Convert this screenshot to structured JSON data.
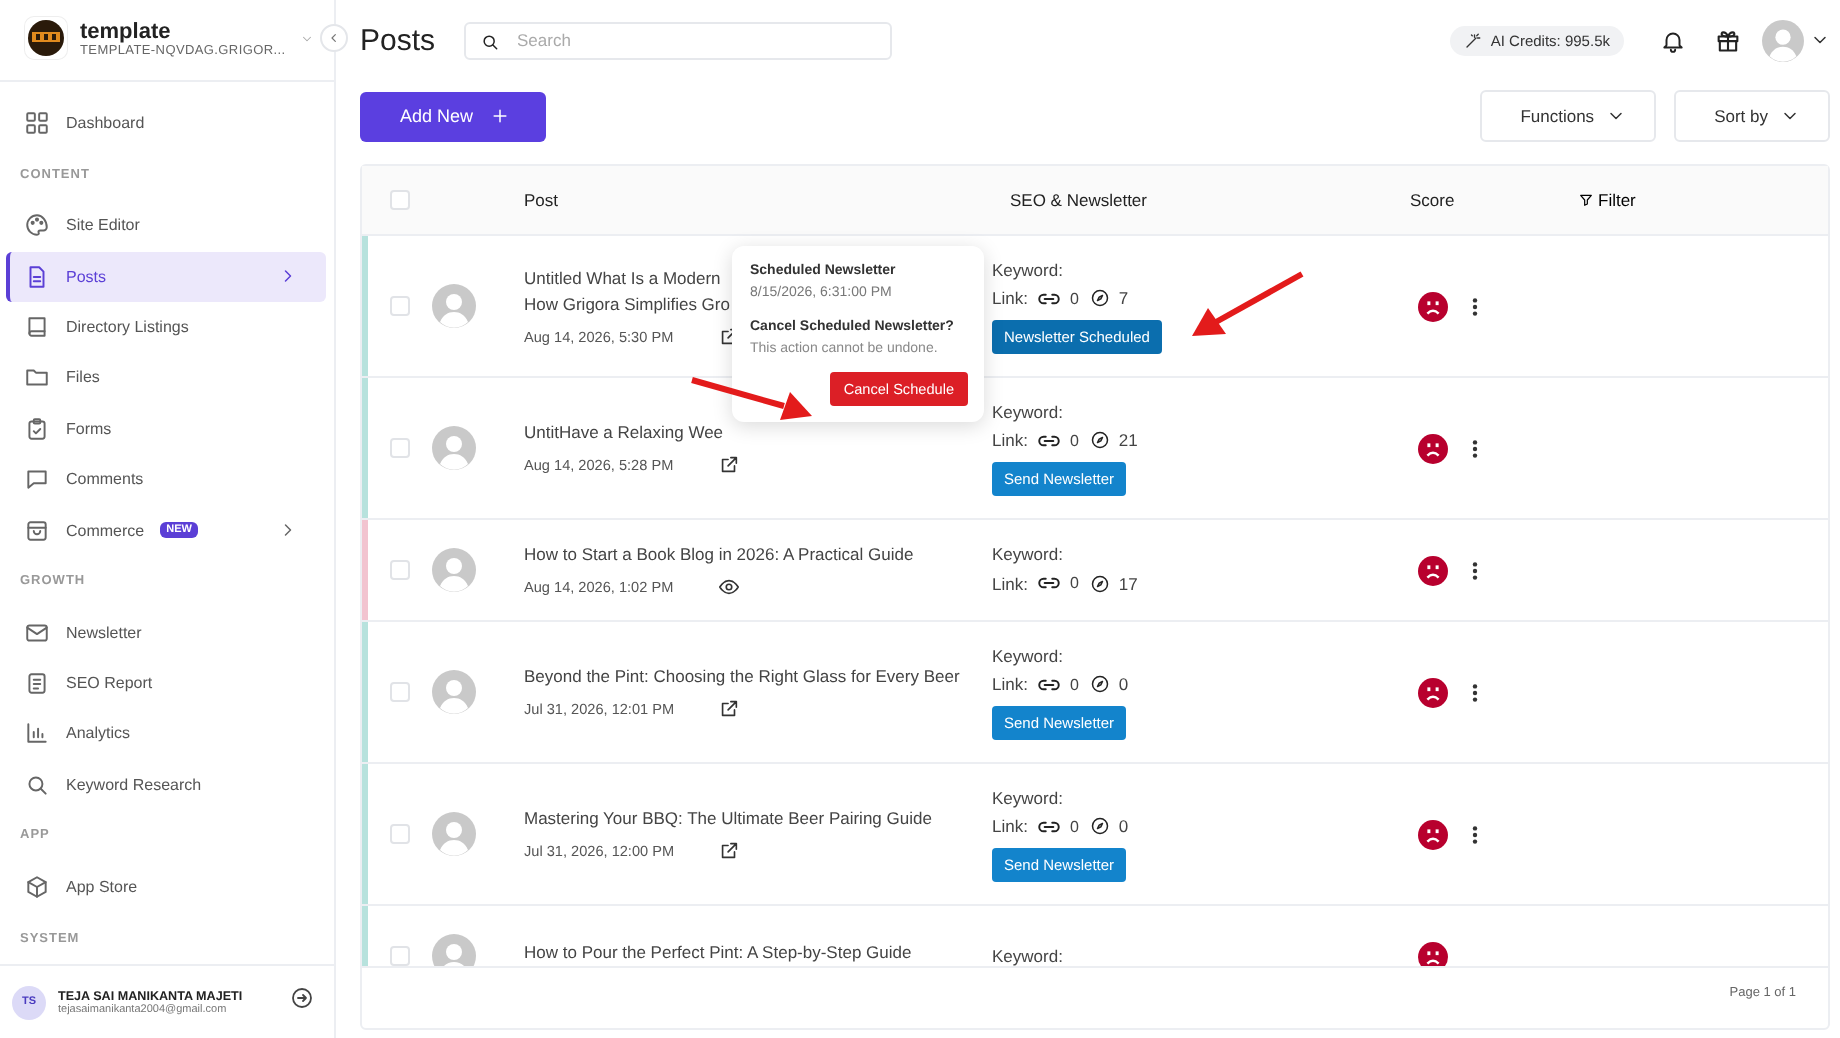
{
  "sidebar": {
    "workspace": {
      "name": "template",
      "domain": "TEMPLATE-NQVDAG.GRIGOR..."
    },
    "items": [
      {
        "kind": "item",
        "label": "Dashboard",
        "selected": false,
        "has_submenu": false
      },
      {
        "kind": "heading",
        "label": "CONTENT"
      },
      {
        "kind": "item",
        "label": "Site Editor",
        "selected": false,
        "has_submenu": false
      },
      {
        "kind": "item",
        "label": "Posts",
        "selected": true,
        "has_submenu": true
      },
      {
        "kind": "item",
        "label": "Directory Listings",
        "selected": false,
        "has_submenu": false
      },
      {
        "kind": "item",
        "label": "Files",
        "selected": false,
        "has_submenu": false
      },
      {
        "kind": "item",
        "label": "Forms",
        "selected": false,
        "has_submenu": false
      },
      {
        "kind": "item",
        "label": "Comments",
        "selected": false,
        "has_submenu": false
      },
      {
        "kind": "item",
        "label": "Commerce",
        "badge": "NEW",
        "selected": false,
        "has_submenu": true
      },
      {
        "kind": "heading",
        "label": "GROWTH"
      },
      {
        "kind": "item",
        "label": "Newsletter",
        "selected": false,
        "has_submenu": false
      },
      {
        "kind": "item",
        "label": "SEO Report",
        "selected": false,
        "has_submenu": false
      },
      {
        "kind": "item",
        "label": "Analytics",
        "selected": false,
        "has_submenu": false
      },
      {
        "kind": "item",
        "label": "Keyword Research",
        "selected": false,
        "has_submenu": false
      },
      {
        "kind": "heading",
        "label": "APP"
      },
      {
        "kind": "item",
        "label": "App Store",
        "selected": false,
        "has_submenu": false
      },
      {
        "kind": "heading",
        "label": "SYSTEM"
      }
    ],
    "user": {
      "initials": "TS",
      "name": "TEJA SAI MANIKANTA MAJETI",
      "email": "tejasaimanikanta2004@gmail.com"
    }
  },
  "header": {
    "title": "Posts",
    "search": {
      "placeholder": "Search"
    },
    "ai_credits": "AI Credits: 995.5k"
  },
  "toolbar": {
    "add_new": "Add New",
    "functions": "Functions",
    "sort_by": "Sort by"
  },
  "table": {
    "columns": [
      "Post",
      "SEO & Newsletter",
      "Score",
      "Filter"
    ],
    "header_checked": false,
    "rows": [
      {
        "title": "Untitled What Is a Modern\nHow Grigora Simplifies Gro",
        "date": "Aug 14, 2026, 5:30 PM",
        "action": {
          "kind": "link"
        },
        "checked": false,
        "color": "#b7e2dd",
        "keyword": "Keyword:",
        "link_label": "Link:",
        "links": "0",
        "views": "7",
        "newsletter": {
          "kind": "scheduled",
          "label": "Newsletter Scheduled"
        },
        "score": {
          "kind": "poor"
        }
      },
      {
        "title": "UntitHave a Relaxing Wee",
        "date": "Aug 14, 2026, 5:28 PM",
        "action": {
          "kind": "link"
        },
        "checked": false,
        "color": "#b7e2dd",
        "keyword": "Keyword:",
        "link_label": "Link:",
        "links": "0",
        "views": "21",
        "newsletter": {
          "kind": "send",
          "label": "Send Newsletter"
        },
        "score": {
          "kind": "poor"
        }
      },
      {
        "title": "How to Start a Book Blog in 2026: A Practical Guide",
        "date": "Aug 14, 2026, 1:02 PM",
        "action": {
          "kind": "preview"
        },
        "checked": false,
        "color": "#f2c4d0",
        "keyword": "Keyword:",
        "link_label": "Link:",
        "links": "0",
        "views": "17",
        "score": {
          "kind": "poor"
        }
      },
      {
        "title": "Beyond the Pint: Choosing the Right Glass for Every Beer",
        "date": "Jul 31, 2026, 12:01 PM",
        "action": {
          "kind": "link"
        },
        "checked": false,
        "color": "#b7e2dd",
        "keyword": "Keyword:",
        "link_label": "Link:",
        "links": "0",
        "views": "0",
        "newsletter": {
          "kind": "send",
          "label": "Send Newsletter"
        },
        "score": {
          "kind": "poor"
        }
      },
      {
        "title": "Mastering Your BBQ: The Ultimate Beer Pairing Guide",
        "date": "Jul 31, 2026, 12:00 PM",
        "action": {
          "kind": "link"
        },
        "checked": false,
        "color": "#b7e2dd",
        "keyword": "Keyword:",
        "link_label": "Link:",
        "links": "0",
        "views": "0",
        "newsletter": {
          "kind": "send",
          "label": "Send Newsletter"
        },
        "score": {
          "kind": "poor"
        }
      },
      {
        "title": "How to Pour the Perfect Pint: A Step-by-Step Guide",
        "checked": false,
        "color": "#b7e2dd",
        "keyword": "Keyword:",
        "score": {
          "kind": "poor"
        }
      }
    ],
    "pagination": "Page 1 of 1"
  },
  "popover": {
    "title": "Scheduled Newsletter",
    "datetime": "8/15/2026, 6:31:00 PM",
    "question": "Cancel Scheduled Newsletter?",
    "warning": "This action cannot be undone.",
    "button": "Cancel Schedule"
  }
}
